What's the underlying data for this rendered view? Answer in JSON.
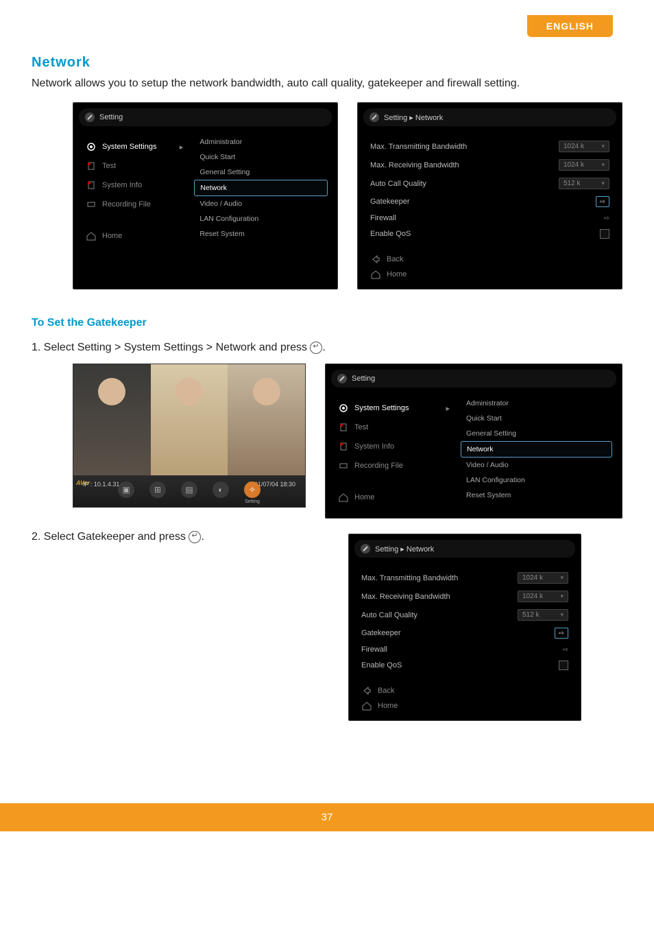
{
  "language_tab": "ENGLISH",
  "section_title": "Network",
  "intro": "Network allows you to setup the network bandwidth, auto call quality, gatekeeper and firewall setting.",
  "sub_title": "To Set the Gatekeeper",
  "step1_prefix": "1. Select Setting > System Settings > Network and press ",
  "step1_suffix": ".",
  "step2_prefix": "2. Select Gatekeeper and press ",
  "step2_suffix": ".",
  "page_number": "37",
  "settings_panel": {
    "crumb": "Setting",
    "sidebar": {
      "system_settings": "System Settings",
      "test": "Test",
      "system_info": "System Info",
      "recording_file": "Recording File",
      "home": "Home"
    },
    "menu": {
      "administrator": "Administrator",
      "quick_start": "Quick Start",
      "general_setting": "General Setting",
      "network": "Network",
      "video_audio": "Video / Audio",
      "lan_config": "LAN Configuration",
      "reset_system": "Reset System"
    }
  },
  "network_panel": {
    "crumb": "Setting ▸ Network",
    "rows": {
      "max_tx": "Max. Transmitting Bandwidth",
      "max_rx": "Max. Receiving Bandwidth",
      "auto_call": "Auto Call Quality",
      "gatekeeper": "Gatekeeper",
      "firewall": "Firewall",
      "enable_qos": "Enable QoS"
    },
    "values": {
      "max_tx": "1024 k",
      "max_rx": "1024 k",
      "auto_call": "512 k"
    },
    "nav": {
      "back": "Back",
      "home": "Home"
    }
  },
  "video_thumb": {
    "av_tag": "AVer",
    "ip": "IP : 10.1.4.31",
    "datetime": "2011/07/04 18:30",
    "setting_label": "Setting"
  }
}
